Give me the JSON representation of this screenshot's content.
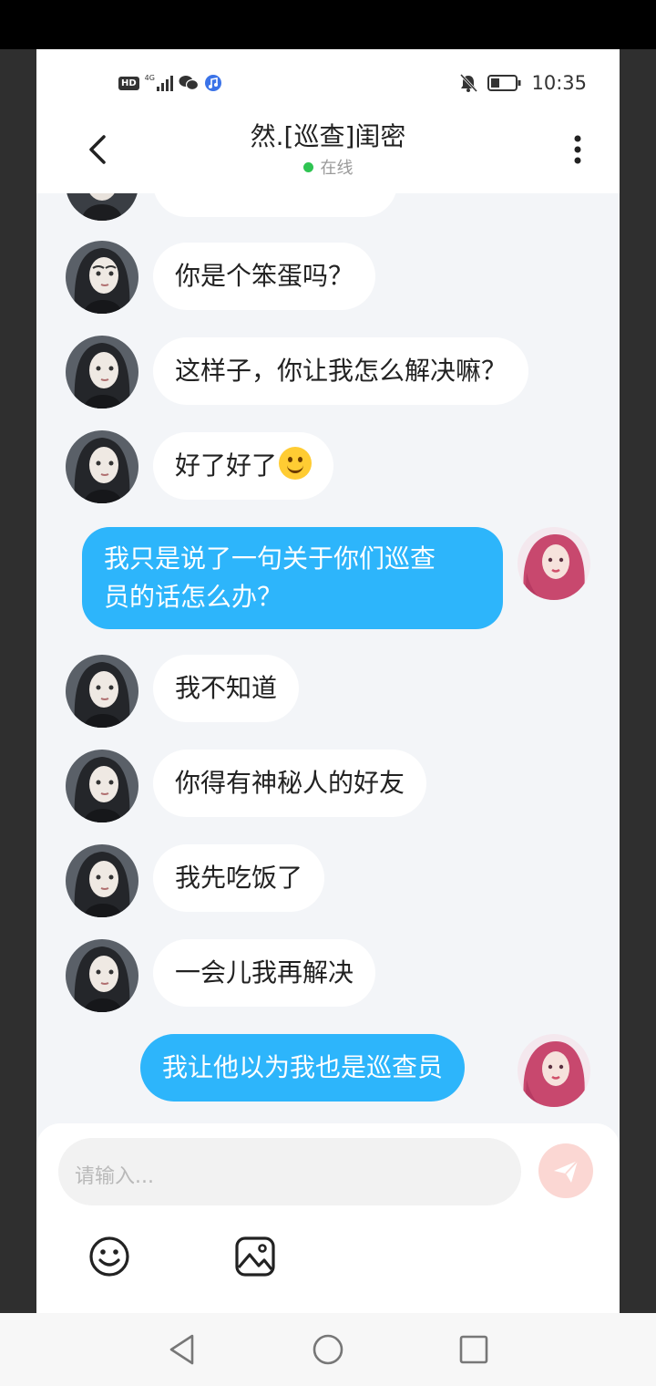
{
  "status_bar": {
    "hd": "HD",
    "network": "4G",
    "time": "10:35"
  },
  "header": {
    "title": "然.[巡查]闺密",
    "status": "在线"
  },
  "colors": {
    "accent_blue": "#2db5fb",
    "online_green": "#2fc452",
    "send_button": "#fbd7d3"
  },
  "messages": [
    {
      "side": "in",
      "text": "你是个笨蛋吗？"
    },
    {
      "side": "in",
      "text": "这样子，你让我怎么解决嘛？"
    },
    {
      "side": "in",
      "text": "好了好了",
      "emoji": "smiling-face-emoji"
    },
    {
      "side": "out",
      "line1": "我只是说了一句关于你们巡查",
      "line2": "员的话怎么办？"
    },
    {
      "side": "in",
      "text": "我不知道"
    },
    {
      "side": "in",
      "text": "你得有神秘人的好友"
    },
    {
      "side": "in",
      "text": "我先吃饭了"
    },
    {
      "side": "in",
      "text": "一会儿我再解决"
    },
    {
      "side": "out",
      "text": "我让他以为我也是巡查员"
    }
  ],
  "composer": {
    "placeholder": "请输入...",
    "icons": [
      "emoji-icon",
      "image-icon",
      "send-icon"
    ]
  },
  "nav_bar": {
    "icons": [
      "back-nav-icon",
      "home-nav-icon",
      "recents-nav-icon"
    ]
  }
}
